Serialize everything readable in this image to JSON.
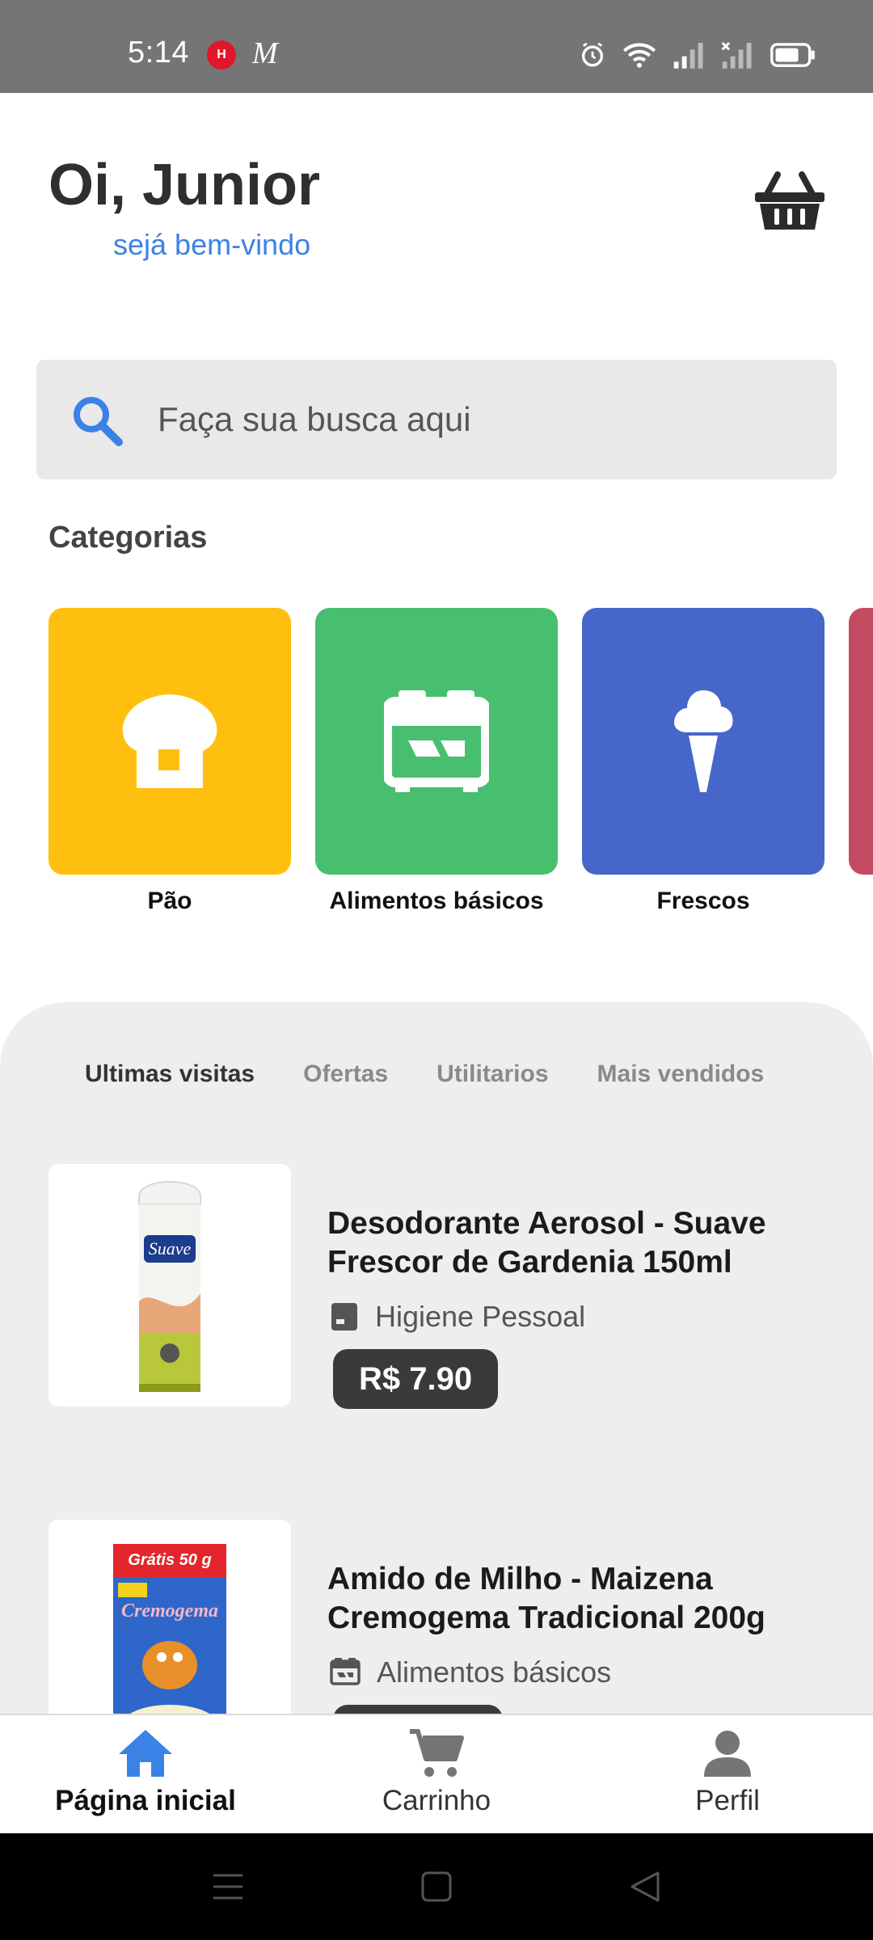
{
  "status_bar": {
    "time": "5:14",
    "app_badge_1": "H",
    "app_badge_2": "M",
    "icons": [
      "alarm-icon",
      "wifi-icon",
      "signal-icon",
      "signal-no-service-icon",
      "battery-icon"
    ]
  },
  "header": {
    "greeting": "Oi, Junior",
    "subtitle": "sejá bem-vindo",
    "cart_icon": "basket-icon"
  },
  "search": {
    "placeholder": "Faça sua busca aqui",
    "icon": "search-icon"
  },
  "categories": {
    "title": "Categorias",
    "items": [
      {
        "label": "Pão",
        "color": "#FFBF0F",
        "icon": "bread-icon"
      },
      {
        "label": "Alimentos básicos",
        "color": "#48BE6F",
        "icon": "stove-icon"
      },
      {
        "label": "Frescos",
        "color": "#4666CA",
        "icon": "ice-cream-icon"
      },
      {
        "label": "",
        "color": "#C44A62",
        "icon": ""
      }
    ]
  },
  "tabs": [
    {
      "label": "Ultimas visitas",
      "active": true
    },
    {
      "label": "Ofertas",
      "active": false
    },
    {
      "label": "Utilitarios",
      "active": false
    },
    {
      "label": "Mais vendidos",
      "active": false
    }
  ],
  "products": [
    {
      "title": "Desodorante Aerosol - Suave Frescor de Gardenia 150ml",
      "category": "Higiene Pessoal",
      "category_icon": "hygiene-icon",
      "price": "R$ 7.90",
      "image_brand": "Suave"
    },
    {
      "title": "Amido de Milho - Maizena Cremogema Tradicional 200g",
      "category": "Alimentos básicos",
      "category_icon": "stove-icon",
      "price": "",
      "image_brand": "Cremogema",
      "image_promo": "Grátis 50 g"
    }
  ],
  "bottom_nav": [
    {
      "label": "Página inicial",
      "icon": "home-icon",
      "active": true,
      "color": "#3B82E6"
    },
    {
      "label": "Carrinho",
      "icon": "cart-icon",
      "active": false,
      "color": "#757575"
    },
    {
      "label": "Perfil",
      "icon": "person-icon",
      "active": false,
      "color": "#757575"
    }
  ],
  "system_nav": [
    "menu-icon",
    "home-square-icon",
    "back-icon"
  ]
}
